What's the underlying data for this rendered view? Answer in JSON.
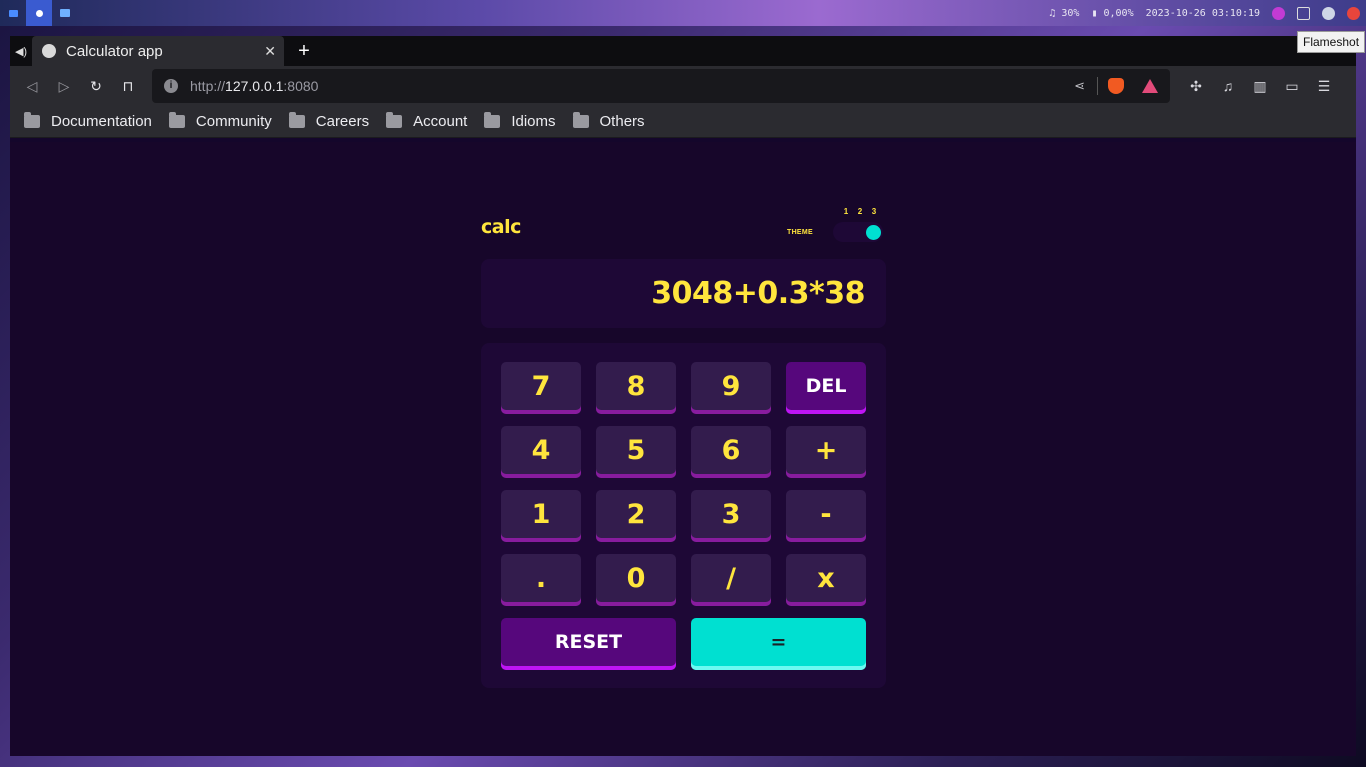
{
  "desktop": {
    "volume": "♫ 30%",
    "battery": "0,00%",
    "datetime": "2023-10-26 03:10:19",
    "tooltip": "Flameshot"
  },
  "browser": {
    "tab": {
      "title": "Calculator app",
      "close": "✕"
    },
    "new_tab": "+",
    "url": {
      "host": "127.0.0.1",
      "scheme": "http://",
      "port": ":8080"
    },
    "bookmarks": [
      "Documentation",
      "Community",
      "Careers",
      "Account",
      "Idioms",
      "Others"
    ]
  },
  "calculator": {
    "logo": "calc",
    "theme": {
      "label": "THEME",
      "options": [
        "1",
        "2",
        "3"
      ],
      "selected": 3
    },
    "display": "3048+0.3*38",
    "keys": {
      "k7": "7",
      "k8": "8",
      "k9": "9",
      "del": "DEL",
      "k4": "4",
      "k5": "5",
      "k6": "6",
      "plus": "+",
      "k1": "1",
      "k2": "2",
      "k3": "3",
      "minus": "-",
      "dot": ".",
      "k0": "0",
      "divide": "/",
      "multiply": "x",
      "reset": "RESET",
      "equals": "="
    },
    "colors": {
      "background": "#17062a",
      "panel": "#1e0836",
      "text": "#ffe53d",
      "key": "#331c4d",
      "accent": "#56077c",
      "equals": "#00e0d1"
    }
  }
}
